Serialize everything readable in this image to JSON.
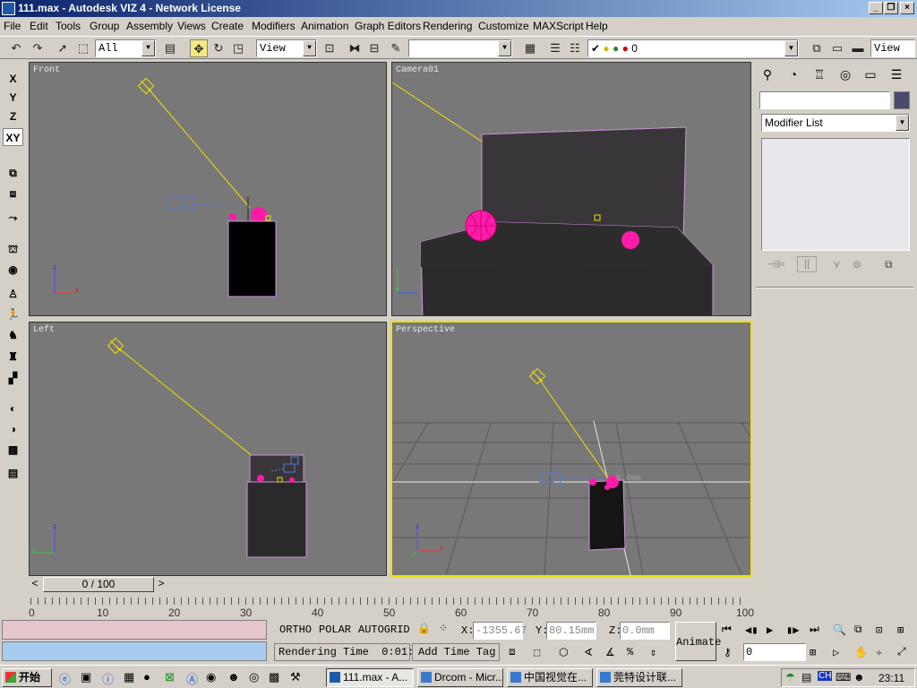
{
  "window": {
    "title": "111.max - Autodesk VIZ 4 - Network License"
  },
  "menu": [
    "File",
    "Edit",
    "Tools",
    "Group",
    "Assembly",
    "Views",
    "Create",
    "Modifiers",
    "Animation",
    "Graph Editors",
    "Rendering",
    "Customize",
    "MAXScript",
    "Help"
  ],
  "toolbar": {
    "selection_filter": "All",
    "ref_coord": "View",
    "named_selection": "",
    "layer": "0",
    "view_right": "View"
  },
  "axis_buttons": [
    "X",
    "Y",
    "Z",
    "XY"
  ],
  "viewports": {
    "front": "Front",
    "camera": "Camera01",
    "left": "Left",
    "perspective": "Perspective"
  },
  "perspective_overlay": "0.0mm",
  "time": {
    "slider": "0 / 100",
    "ticks": [
      "0",
      "10",
      "20",
      "30",
      "40",
      "50",
      "60",
      "70",
      "80",
      "90",
      "100"
    ]
  },
  "command_panel": {
    "modifier_list": "Modifier List"
  },
  "status": {
    "modes": [
      "ORTHO",
      "POLAR",
      "AUTOGRID"
    ],
    "x_label": "X:",
    "x_value": "-1355.67",
    "y_label": "Y:",
    "y_value": "80.15mm",
    "z_label": "Z:",
    "z_value": "0.0mm",
    "rendering_time": "Rendering Time  0:01:",
    "add_time_tag": "Add Time Tag",
    "animate": "Animate",
    "frame": "0"
  },
  "taskbar": {
    "start": "开始",
    "tasks": [
      "111.max - A...",
      "Drcom - Micr...",
      "中国视觉在...",
      "莞特设计联..."
    ],
    "clock": "23:11"
  },
  "colors": {
    "title_start": "#0a246a",
    "viewport_bg": "#787878",
    "active_border": "#f0e000",
    "helper_pink": "#ff1aa8",
    "light_yellow": "#f0e000"
  }
}
